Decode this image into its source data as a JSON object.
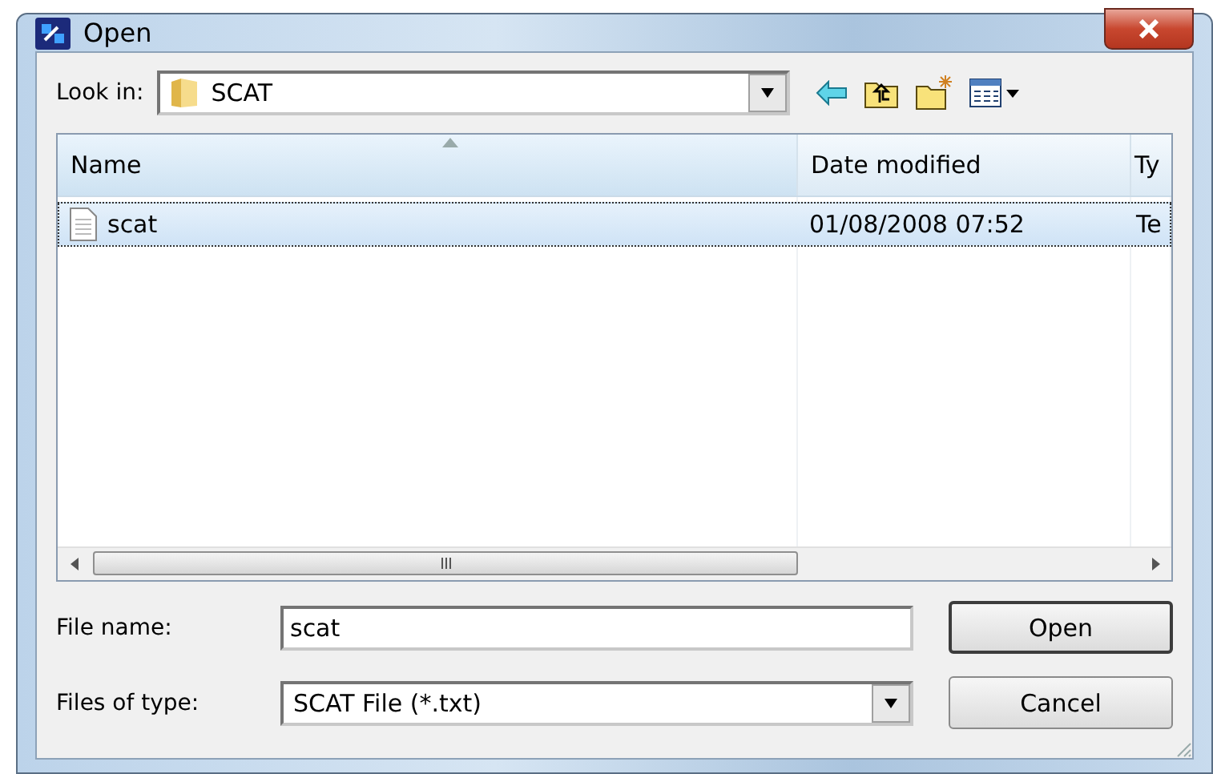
{
  "window": {
    "title": "Open"
  },
  "look_in": {
    "label": "Look in:",
    "value": "SCAT"
  },
  "file_list": {
    "columns": [
      {
        "label": "Name",
        "sorted": true
      },
      {
        "label": "Date modified",
        "sorted": false
      },
      {
        "label": "Ty",
        "sorted": false
      }
    ],
    "rows": [
      {
        "cells": [
          "scat",
          "01/08/2008 07:52",
          "Te"
        ],
        "selected": true
      }
    ]
  },
  "file_name": {
    "label": "File name:",
    "value": "scat"
  },
  "file_type": {
    "label": "Files of type:",
    "value": "SCAT File (*.txt)"
  },
  "buttons": [
    {
      "label": "Open",
      "default": true
    },
    {
      "label": "Cancel",
      "default": false
    }
  ]
}
